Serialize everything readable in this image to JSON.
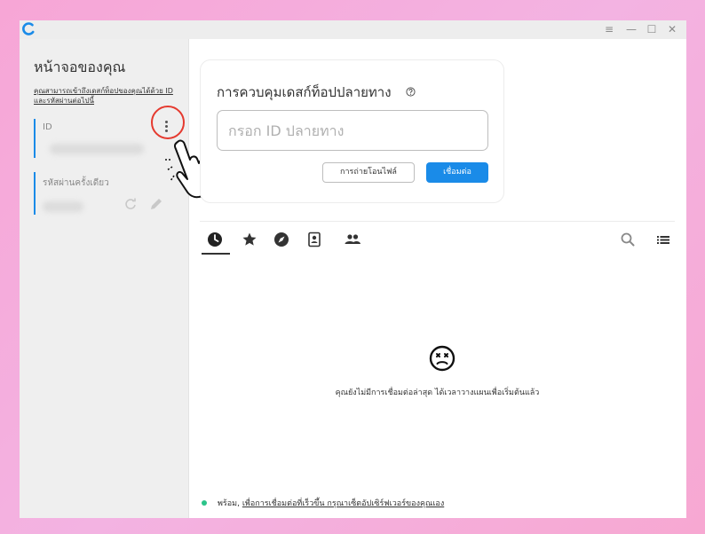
{
  "window": {
    "title_controls": [
      "≡",
      "—",
      "☐",
      "✕"
    ]
  },
  "sidebar": {
    "title": "หน้าจอของคุณ",
    "description": "คุณสามารถเข้าถึงเดสก์ท็อปของคุณได้ด้วย ID และรหัสผ่านต่อไปนี้",
    "id_label": "ID",
    "id_value": "",
    "password_label": "รหัสผ่านครั้งเดียว",
    "password_value": ""
  },
  "control": {
    "title": "การควบคุมเดสก์ท็อปปลายทาง",
    "input_placeholder": "กรอก ID ปลายทาง",
    "transfer_button": "การถ่ายโอนไฟล์",
    "connect_button": "เชื่อมต่อ"
  },
  "tabs": [
    {
      "icon": "clock-icon",
      "active": true
    },
    {
      "icon": "star-icon",
      "active": false
    },
    {
      "icon": "compass-icon",
      "active": false
    },
    {
      "icon": "address-book-icon",
      "active": false
    },
    {
      "icon": "group-icon",
      "active": false
    }
  ],
  "empty_state": {
    "message": "คุณยังไม่มีการเชื่อมต่อล่าสุด ได้เวลาวางแผนเพื่อเริ่มต้นแล้ว"
  },
  "status": {
    "ready": "พร้อม,",
    "link_text": "เพื่อการเชื่อมต่อที่เร็วขึ้น กรุณาเซ็ตอัปเซิร์ฟเวอร์ของคุณเอง"
  },
  "colors": {
    "accent": "#1a8be8",
    "status_ok": "#2bc48a",
    "highlight": "#e53a2f",
    "border_pink": "#f7a6d6"
  }
}
